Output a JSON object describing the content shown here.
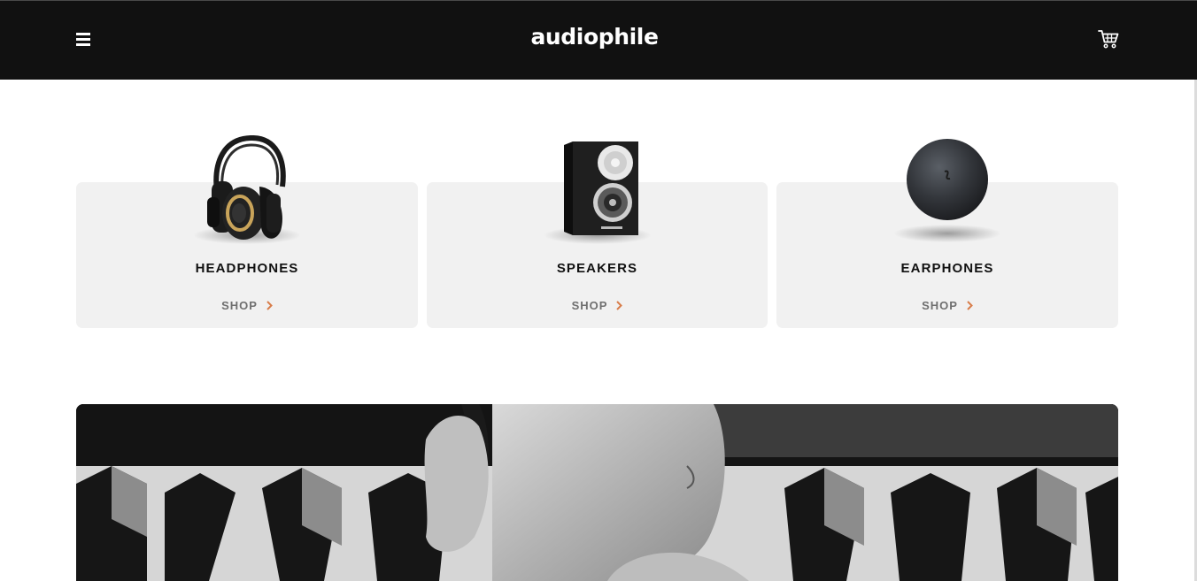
{
  "header": {
    "logo": "audiophile",
    "menu_icon": "hamburger-menu-icon",
    "cart_icon": "shopping-cart-icon",
    "background": "#111111"
  },
  "categories": [
    {
      "title": "HEADPHONES",
      "shop_label": "SHOP",
      "image": "headphones-image"
    },
    {
      "title": "SPEAKERS",
      "shop_label": "SHOP",
      "image": "speaker-image"
    },
    {
      "title": "EARPHONES",
      "shop_label": "SHOP",
      "image": "earphones-image"
    }
  ],
  "colors": {
    "accent": "#d87d4a",
    "card_background": "#f1f1f1",
    "text_dark": "#111111",
    "text_muted": "#6f6f6f"
  },
  "hero": {
    "image": "man-wearing-headphones-photo"
  }
}
